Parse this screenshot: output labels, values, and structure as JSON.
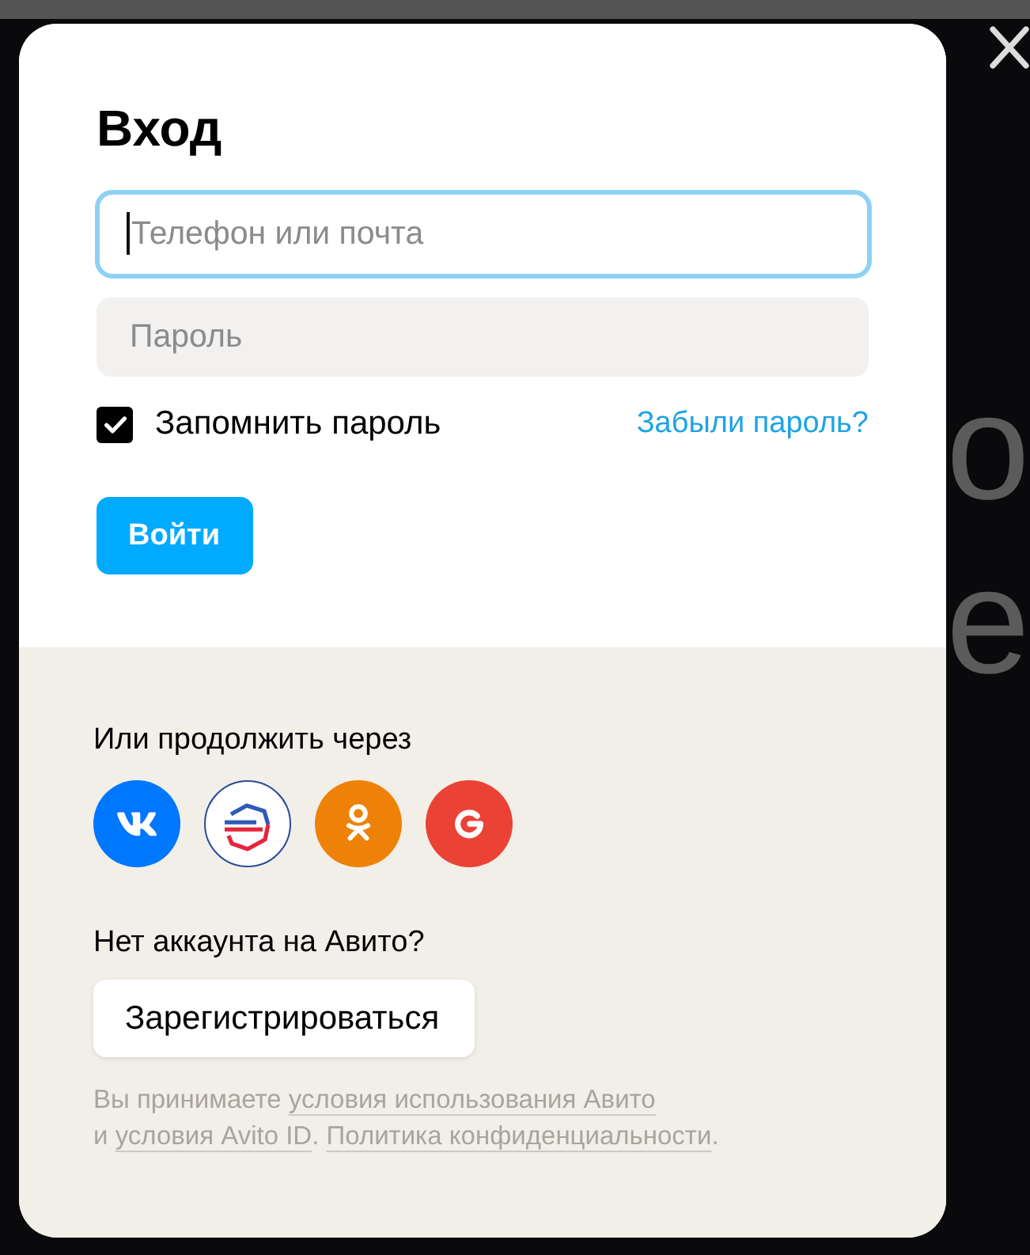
{
  "backdrop": {
    "letters": [
      "o",
      "e"
    ]
  },
  "dialog": {
    "title": "Вход",
    "fields": [
      {
        "placeholder": "Телефон или почта",
        "focused": true
      },
      {
        "placeholder": "Пароль",
        "focused": false
      }
    ],
    "remember": {
      "label": "Запомнить пароль",
      "checked": true
    },
    "forgot_link": "Забыли пароль?",
    "submit_button": "Войти"
  },
  "social": {
    "heading": "Или продолжить через",
    "providers": [
      {
        "kind": "vk"
      },
      {
        "kind": "gosuslugi"
      },
      {
        "kind": "ok"
      },
      {
        "kind": "google"
      }
    ]
  },
  "register": {
    "question": "Нет аккаунта на Авито?",
    "button": "Зарегистрироваться"
  },
  "legal": {
    "lines": [
      [
        {
          "kind": "text",
          "text": "Вы принимаете "
        },
        {
          "kind": "link",
          "text": "условия использования Авито"
        }
      ],
      [
        {
          "kind": "text",
          "text": "и "
        },
        {
          "kind": "link",
          "text": "условия Avito ID"
        },
        {
          "kind": "text",
          "text": ". "
        },
        {
          "kind": "link",
          "text": "Политика конфиденциальности"
        },
        {
          "kind": "text",
          "text": "."
        }
      ]
    ]
  }
}
